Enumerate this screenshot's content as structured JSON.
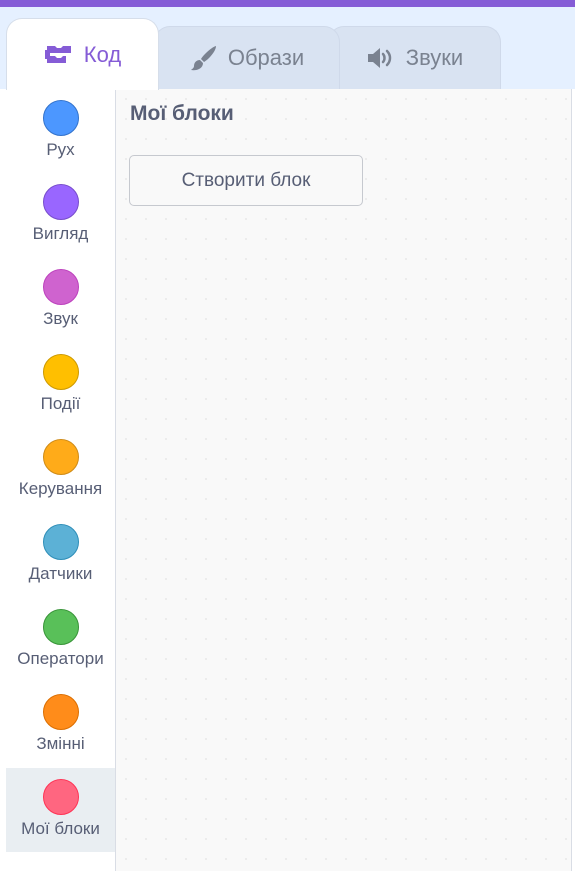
{
  "tabs": [
    {
      "label": "Код",
      "icon": "code-icon",
      "active": true
    },
    {
      "label": "Образи",
      "icon": "brush-icon",
      "active": false
    },
    {
      "label": "Звуки",
      "icon": "speaker-icon",
      "active": false
    }
  ],
  "categories": [
    {
      "label": "Рух",
      "color": "#4c97ff",
      "border": "#3373cc"
    },
    {
      "label": "Вигляд",
      "color": "#9966ff",
      "border": "#774dcb"
    },
    {
      "label": "Звук",
      "color": "#cf63cf",
      "border": "#bd42bd"
    },
    {
      "label": "Події",
      "color": "#ffbf00",
      "border": "#cc9900"
    },
    {
      "label": "Керування",
      "color": "#ffab19",
      "border": "#cf8b17"
    },
    {
      "label": "Датчики",
      "color": "#5cb1d6",
      "border": "#2e8eb8"
    },
    {
      "label": "Оператори",
      "color": "#59c059",
      "border": "#389438"
    },
    {
      "label": "Змінні",
      "color": "#ff8c1a",
      "border": "#db6e00"
    },
    {
      "label": "Мої блоки",
      "color": "#ff6680",
      "border": "#ff3355",
      "selected": true
    }
  ],
  "palette": {
    "section_title": "Мої блоки",
    "make_block_label": "Створити блок"
  },
  "colors": {
    "accent": "#855cd6",
    "text": "#575e75"
  }
}
